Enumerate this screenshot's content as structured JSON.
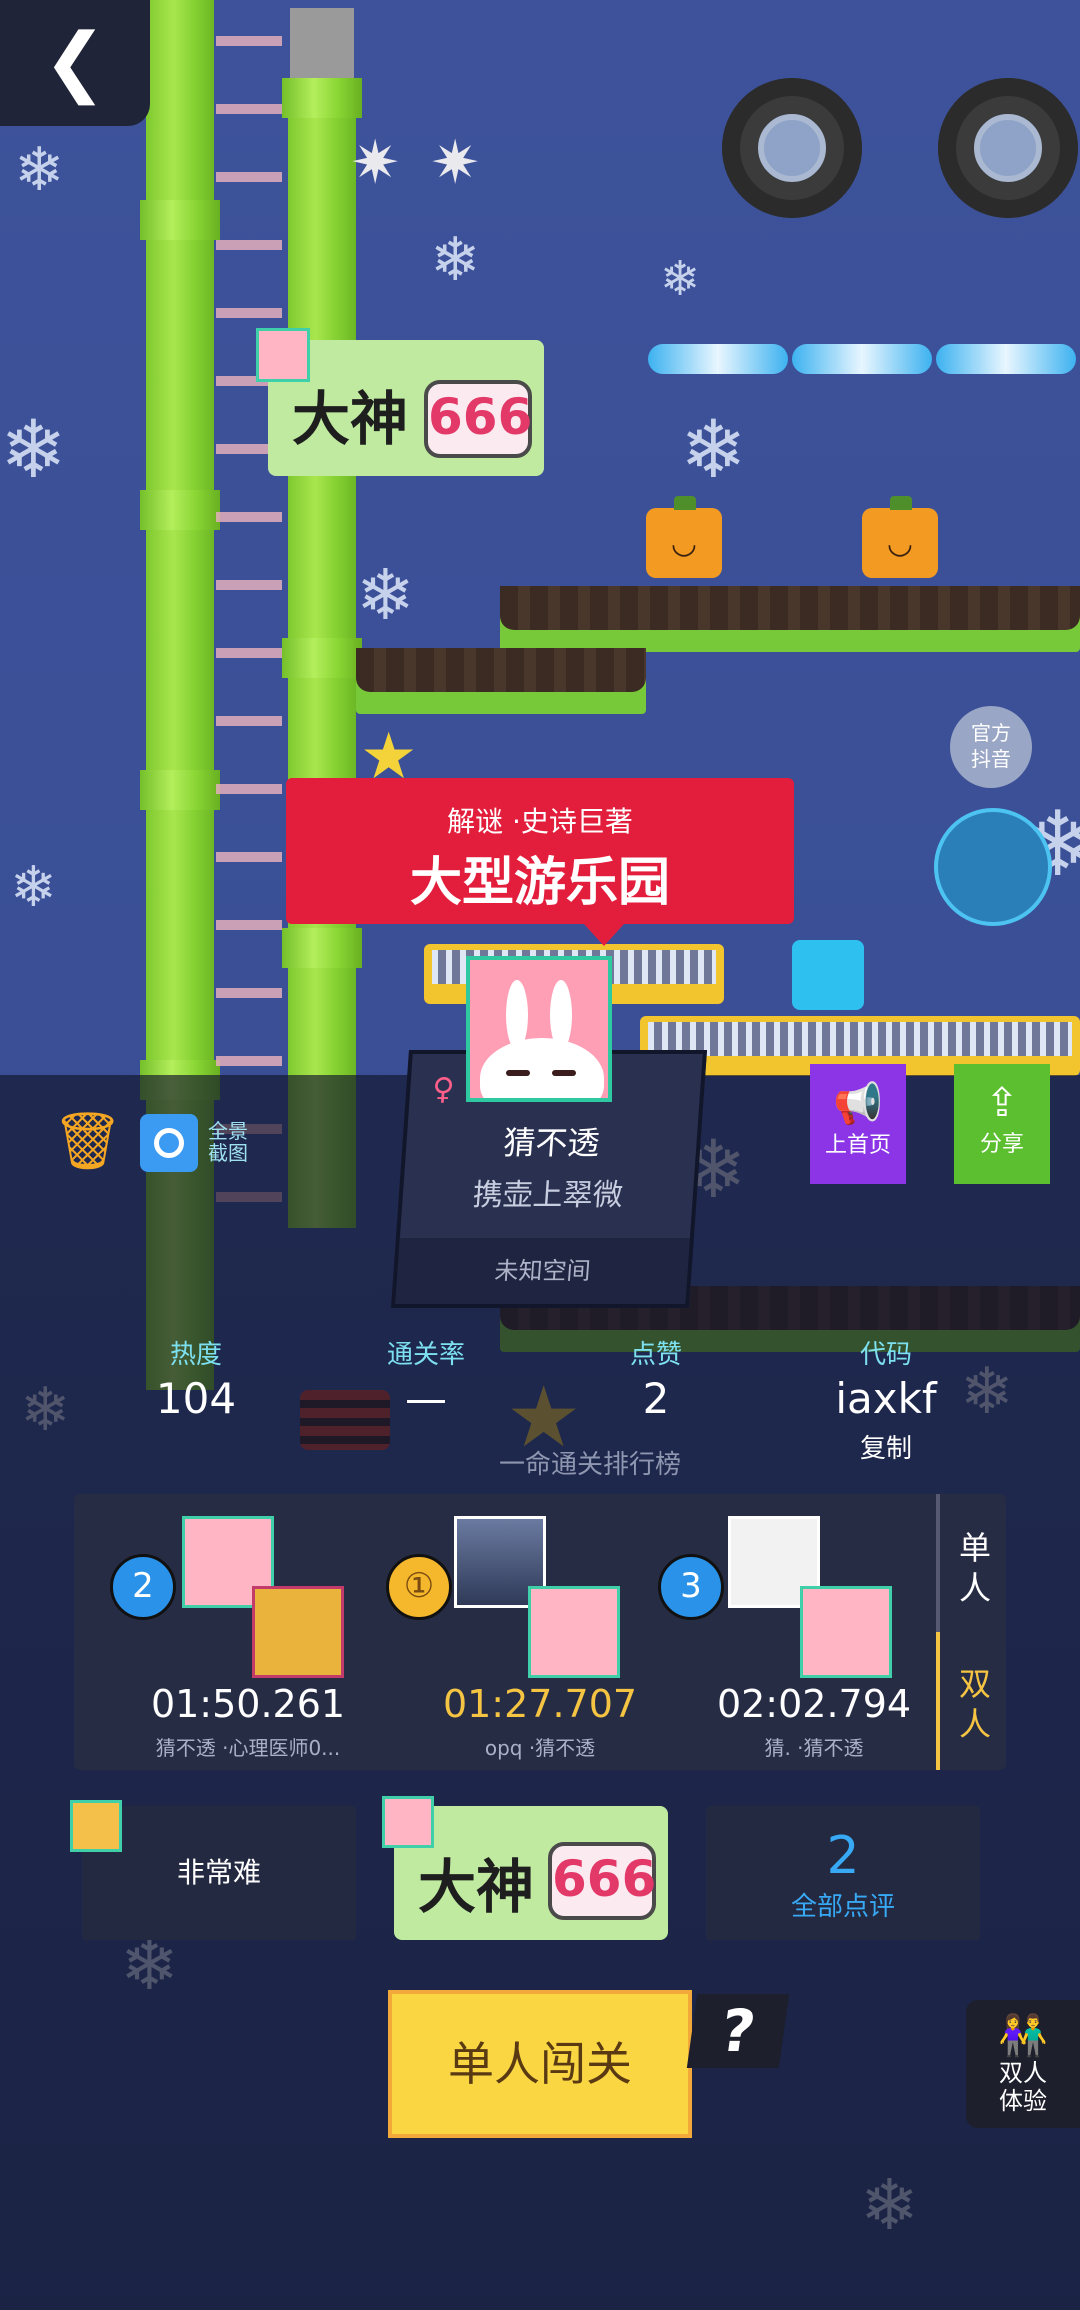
{
  "nav": {
    "back_label": "‹"
  },
  "scene": {
    "sign_top": {
      "label": "大神",
      "badge": "666"
    },
    "side_icon": "官方\n抖音"
  },
  "level": {
    "tags": "解谜 ·史诗巨著",
    "title": "大型游乐园"
  },
  "author": {
    "gender_icon": "♀",
    "name": "猜不透",
    "motto": "携壶上翠微",
    "space": "未知空间"
  },
  "toolbar": {
    "delete_icon": "trash-icon",
    "screenshot_label": "全景\n截图",
    "home_label": "上首页",
    "share_label": "分享"
  },
  "stats": {
    "heat_label": "热度",
    "heat_value": "104",
    "pass_label": "通关率",
    "pass_value": "—",
    "like_label": "点赞",
    "like_value": "2",
    "code_label": "代码",
    "code_value": "iaxkf",
    "copy_label": "复制"
  },
  "ranking": {
    "title": "一命通关排行榜",
    "entries": [
      {
        "rank": "2",
        "time": "01:50.261",
        "names": "猜不透 ·心理医师0..."
      },
      {
        "rank": "①",
        "time": "01:27.707",
        "names": "opq ·猜不透"
      },
      {
        "rank": "3",
        "time": "02:02.794",
        "names": "猜. ·猜不透"
      }
    ],
    "tabs": [
      "单\n人",
      "双\n人"
    ],
    "active_tab": 1
  },
  "bottom": {
    "difficulty": "非常难",
    "sign": {
      "label": "大神",
      "badge": "666"
    },
    "reviews_count": "2",
    "reviews_label": "全部点评",
    "play_label": "单人闯关",
    "help_label": "?",
    "duo_label": "双人\n体验"
  },
  "colors": {
    "accent_gold": "#f5c443",
    "tab_active": "#f5c443",
    "banner_red": "#e21e3c",
    "home_purple": "#8b35e6",
    "share_green": "#5bbf2f"
  }
}
